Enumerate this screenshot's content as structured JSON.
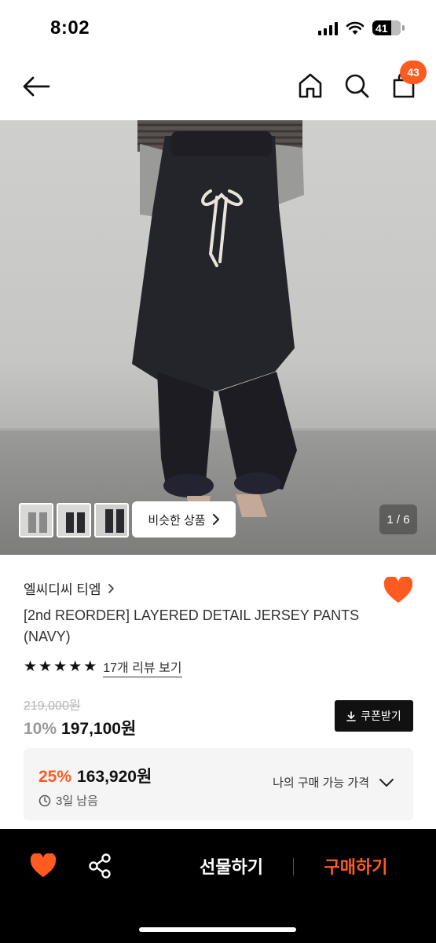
{
  "status_bar": {
    "time": "8:02",
    "battery": "41"
  },
  "nav": {
    "cart_count": "43"
  },
  "gallery": {
    "similar_label": "비슷한 상품",
    "page_indicator": "1 / 6",
    "thumbnail_count": 3
  },
  "product": {
    "brand": "엘씨디씨 티엠",
    "title": "[2nd REORDER] LAYERED DETAIL JERSEY PANTS (NAVY)",
    "rating_stars": 5,
    "review_link": "17개 리뷰 보기",
    "original_price": "219,000원",
    "discount": "10%",
    "price": "197,100원",
    "coupon_label": "쿠폰받기"
  },
  "best_price_box": {
    "discount": "25%",
    "price": "163,920원",
    "time_left": "3일 남음",
    "my_price_label": "나의 구매 가능 가격"
  },
  "bottom_bar": {
    "gift_label": "선물하기",
    "buy_label": "구매하기"
  },
  "colors": {
    "accent": "#ff5a1f",
    "dark": "#111111",
    "muted": "#9a9a9a"
  },
  "icons": [
    "back-arrow-icon",
    "home-icon",
    "search-icon",
    "shopping-bag-icon",
    "heart-icon",
    "share-icon",
    "download-icon",
    "clock-icon",
    "chevron-right-icon",
    "chevron-down-icon",
    "star-icon"
  ]
}
